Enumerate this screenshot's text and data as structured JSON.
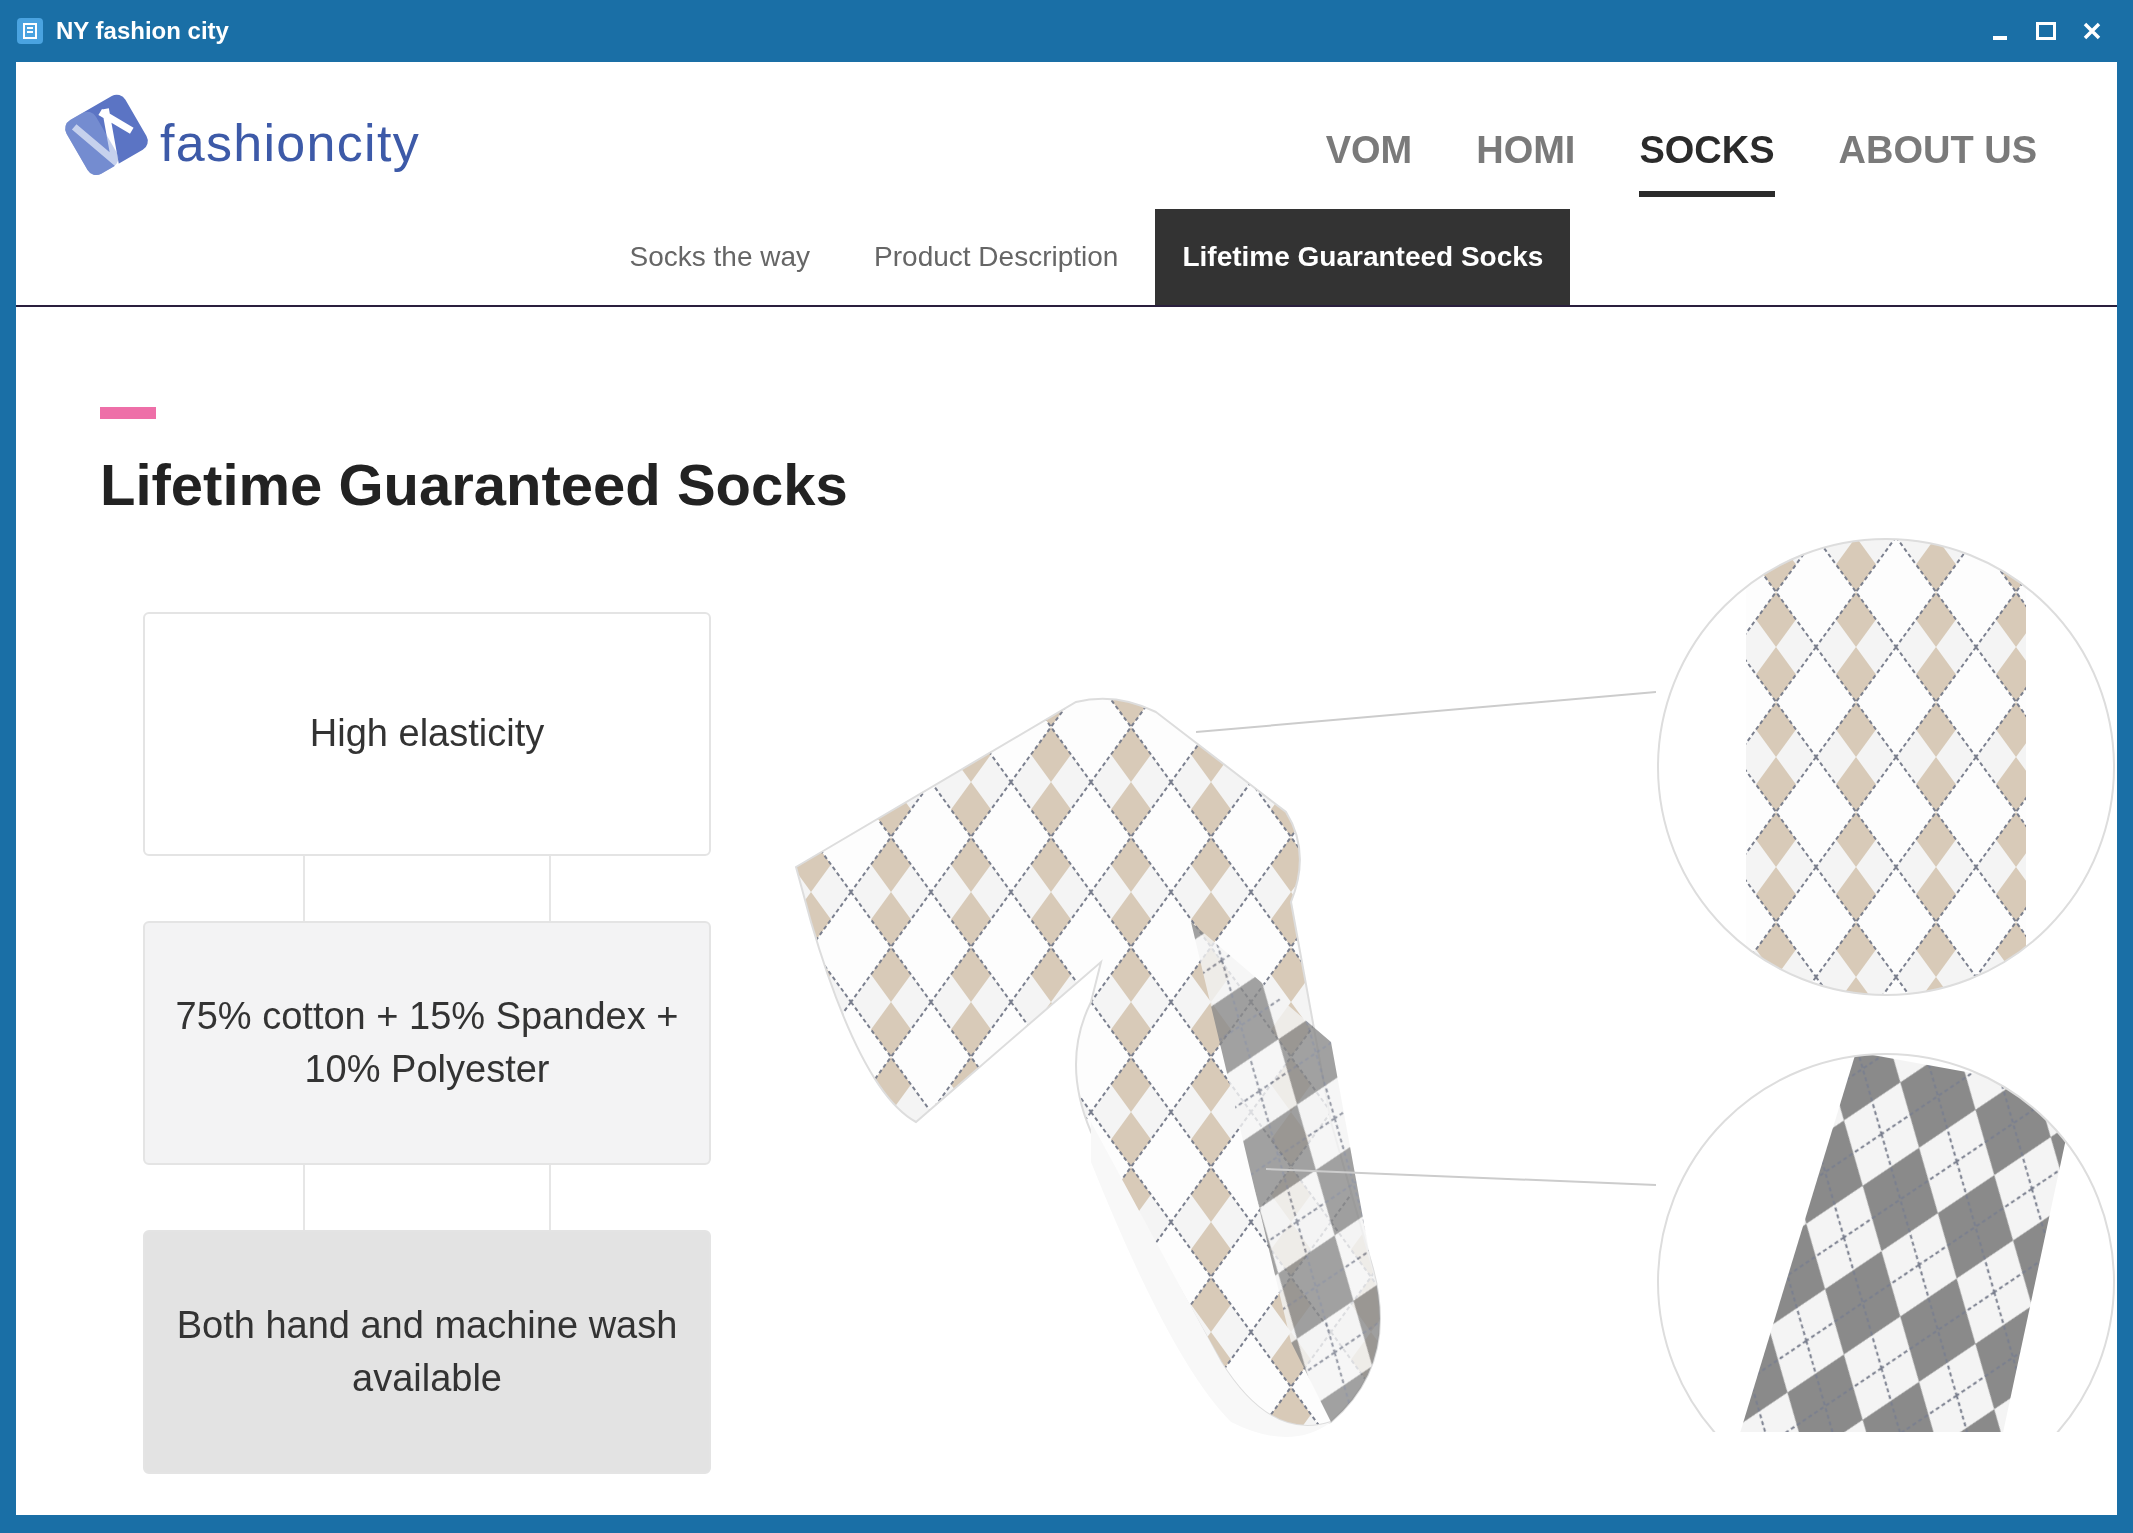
{
  "window": {
    "title": "NY fashion city"
  },
  "logo": {
    "text": "fashioncity"
  },
  "nav": [
    {
      "label": "VOM",
      "selected": false
    },
    {
      "label": "HOMI",
      "selected": false
    },
    {
      "label": "SOCKS",
      "selected": true
    },
    {
      "label": "ABOUT US",
      "selected": false
    }
  ],
  "subnav": [
    {
      "label": "Socks the way",
      "selected": false
    },
    {
      "label": "Product Description",
      "selected": false
    },
    {
      "label": "Lifetime Guaranteed Socks",
      "selected": true
    }
  ],
  "heading": "Lifetime Guaranteed Socks",
  "features": [
    "High elasticity",
    "75% cotton + 15% Spandex + 10% Polyester",
    "Both hand and machine wash available"
  ]
}
